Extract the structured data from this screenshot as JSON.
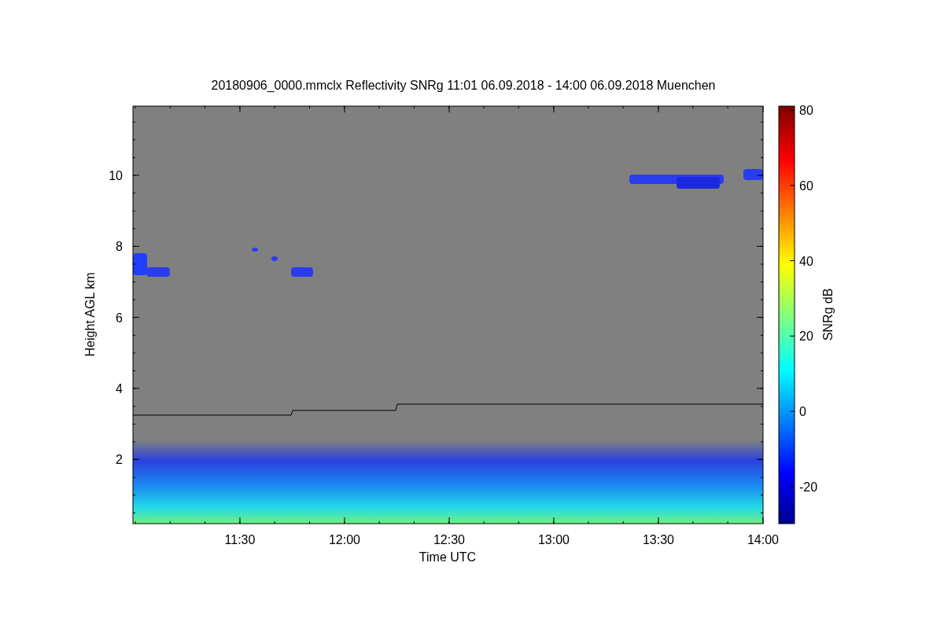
{
  "title": "20180906_0000.mmclx Reflectivity SNRg   11:01 06.09.2018 - 14:00 06.09.2018 Muenchen",
  "y_axis": {
    "label": "Height AGL km",
    "ticks": [
      "10",
      "8",
      "6",
      "4",
      "2"
    ]
  },
  "x_axis": {
    "label": "Time UTC",
    "ticks": [
      "11:30",
      "12:00",
      "12:30",
      "13:00",
      "13:30",
      "14:00"
    ]
  },
  "colorbar": {
    "label": "SNRg dB",
    "ticks": [
      "80",
      "60",
      "40",
      "20",
      "0",
      "-20"
    ]
  }
}
